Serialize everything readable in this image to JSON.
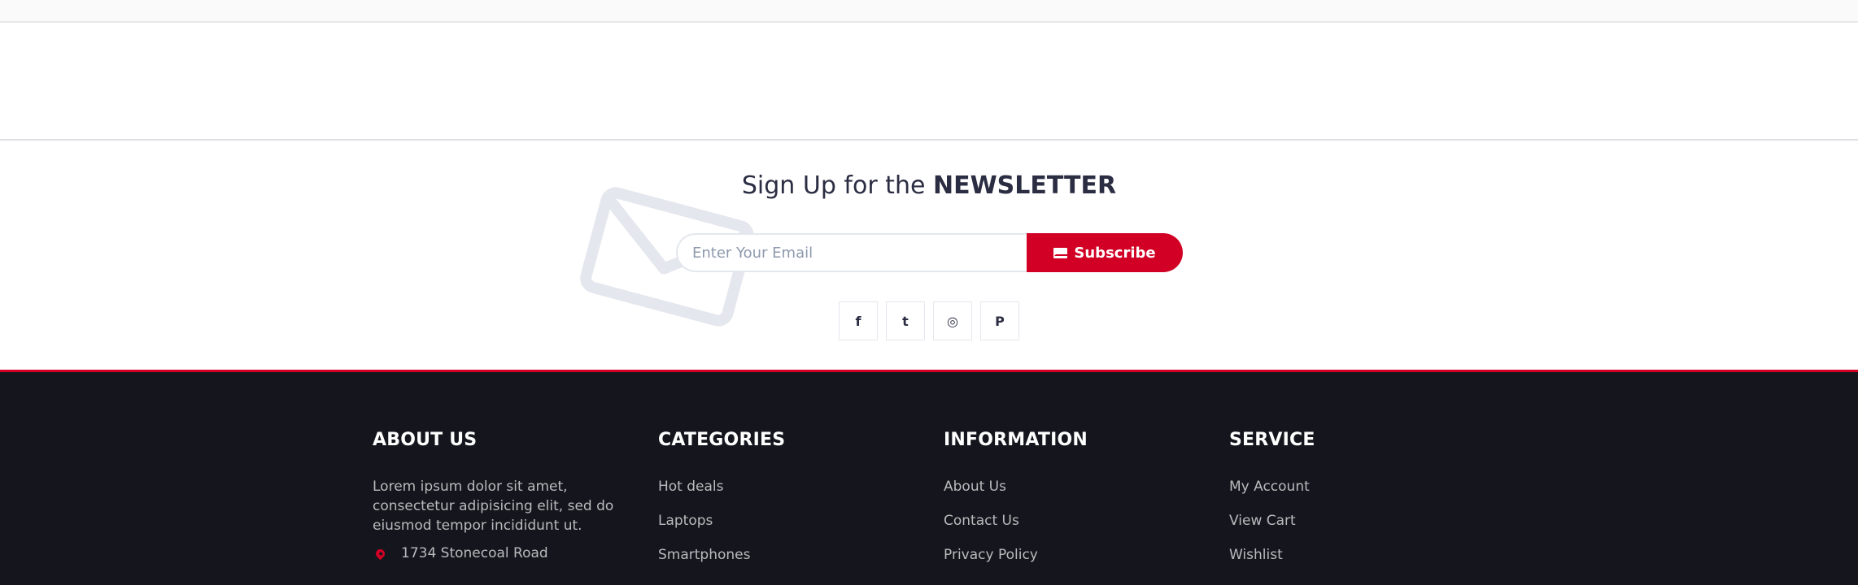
{
  "newsletter": {
    "title_prefix": "Sign Up for the",
    "title_strong": "NEWSLETTER",
    "email_placeholder": "Enter Your Email",
    "subscribe_label": "Subscribe",
    "socials": [
      {
        "name": "facebook-icon",
        "glyph": "f"
      },
      {
        "name": "twitter-icon",
        "glyph": "t"
      },
      {
        "name": "instagram-icon",
        "glyph": "◎"
      },
      {
        "name": "pinterest-icon",
        "glyph": "P"
      }
    ]
  },
  "footer": {
    "about": {
      "title": "ABOUT US",
      "text": "Lorem ipsum dolor sit amet, consectetur adipisicing elit, sed do eiusmod tempor incididunt ut.",
      "address": "1734 Stonecoal Road"
    },
    "categories": {
      "title": "CATEGORIES",
      "items": [
        "Hot deals",
        "Laptops",
        "Smartphones"
      ]
    },
    "information": {
      "title": "INFORMATION",
      "items": [
        "About Us",
        "Contact Us",
        "Privacy Policy"
      ]
    },
    "service": {
      "title": "SERVICE",
      "items": [
        "My Account",
        "View Cart",
        "Wishlist"
      ]
    }
  },
  "colors": {
    "accent": "#d10024",
    "footer_bg": "#15161d",
    "heading": "#2b2d42"
  }
}
